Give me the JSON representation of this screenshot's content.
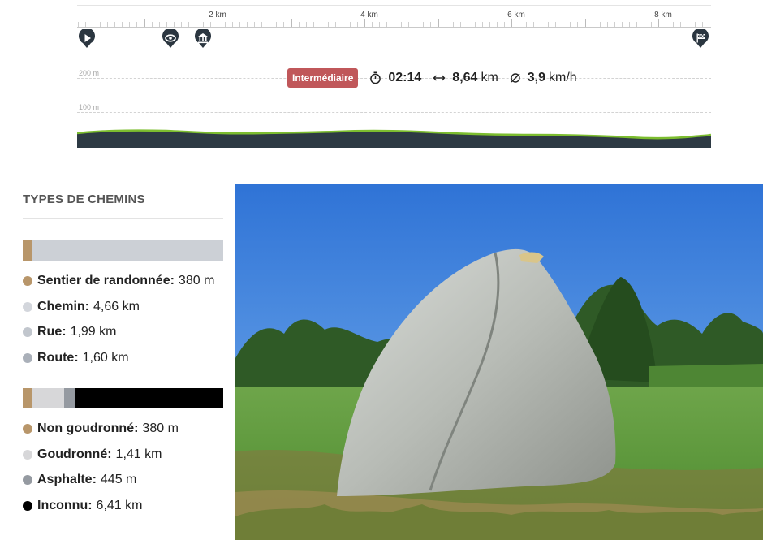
{
  "profile": {
    "km_labels": [
      "2 km",
      "4 km",
      "6 km",
      "8 km"
    ],
    "altitude_labels": [
      "200 m",
      "100 m"
    ],
    "poi_icons": [
      "play-icon",
      "eye-icon",
      "museum-icon",
      "finish-flag-icon"
    ],
    "profile_colors": {
      "line": "#7cbd2f",
      "fill": "#2d3a44"
    }
  },
  "stats": {
    "difficulty": "Intermédiaire",
    "difficulty_color": "#c0575a",
    "duration": "02:14",
    "distance_value": "8,64",
    "distance_unit": "km",
    "speed_value": "3,9",
    "speed_unit": "km/h"
  },
  "path_types": {
    "title": "TYPES DE CHEMINS",
    "path_bar": [
      {
        "color": "#b8966a",
        "fraction": 0.044
      },
      {
        "color": "#ccd0d6",
        "fraction": 0.956
      }
    ],
    "path_legend": [
      {
        "label": "Sentier de randonnée:",
        "value": "380 m",
        "color": "#b8966a"
      },
      {
        "label": "Chemin:",
        "value": "4,66 km",
        "color": "#d3d6dc"
      },
      {
        "label": "Rue:",
        "value": "1,99 km",
        "color": "#c1c6cd"
      },
      {
        "label": "Route:",
        "value": "1,60 km",
        "color": "#aab0b9"
      }
    ],
    "surface_bar": [
      {
        "color": "#b8966a",
        "fraction": 0.044
      },
      {
        "color": "#d7d7d9",
        "fraction": 0.163
      },
      {
        "color": "#959aa1",
        "fraction": 0.051
      },
      {
        "color": "#000000",
        "fraction": 0.742
      }
    ],
    "surface_legend": [
      {
        "label": "Non goudronné:",
        "value": "380 m",
        "color": "#b8966a"
      },
      {
        "label": "Goudronné:",
        "value": "1,41 km",
        "color": "#d7d7d9"
      },
      {
        "label": "Asphalte:",
        "value": "445 m",
        "color": "#959aa1"
      },
      {
        "label": "Inconnu:",
        "value": "6,41 km",
        "color": "#000000"
      }
    ]
  }
}
